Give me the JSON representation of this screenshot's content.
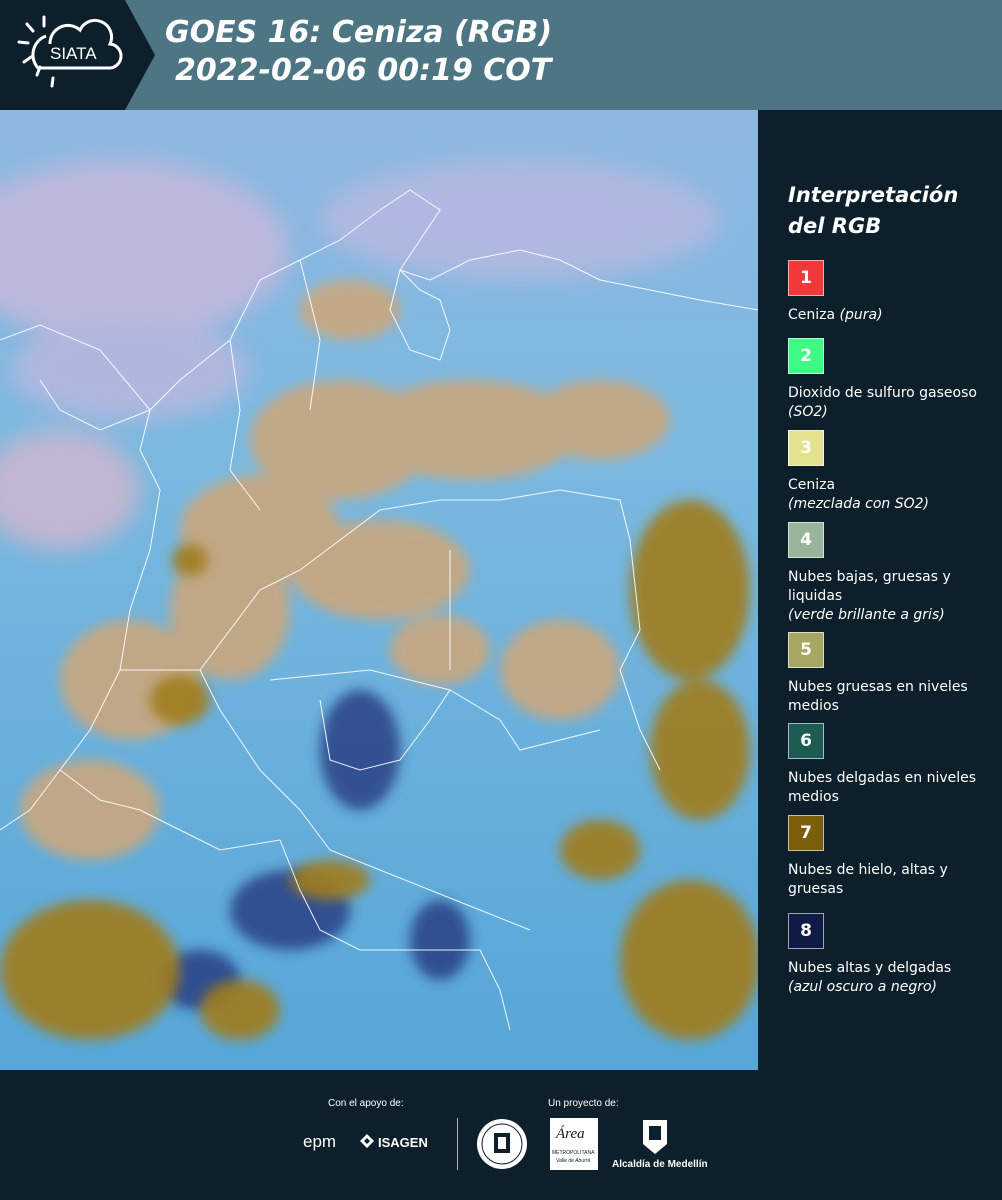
{
  "header": {
    "logo_text": "SIATA",
    "title_line1": "GOES 16: Ceniza (RGB)",
    "title_line2": "2022-02-06 00:19 COT"
  },
  "legend": {
    "title_line1": "Interpretación",
    "title_line2": "del RGB",
    "items": [
      {
        "number": "1",
        "color": "#f0393a",
        "label": "Ceniza",
        "sub": "(pura)"
      },
      {
        "number": "2",
        "color": "#3dfb85",
        "label": "Dioxido de sulfuro gaseoso",
        "sub": "(SO2)"
      },
      {
        "number": "3",
        "color": "#e4e28f",
        "label": "Ceniza",
        "sub": "(mezclada con SO2)"
      },
      {
        "number": "4",
        "color": "#98b49b",
        "label": "Nubes bajas, gruesas y liquidas",
        "sub": "(verde brillante a gris)"
      },
      {
        "number": "5",
        "color": "#a8a762",
        "label": "Nubes gruesas en niveles medios",
        "sub": ""
      },
      {
        "number": "6",
        "color": "#1d5a52",
        "label": "Nubes delgadas en niveles medios",
        "sub": ""
      },
      {
        "number": "7",
        "color": "#7a5e0c",
        "label": "Nubes de hielo, altas y gruesas",
        "sub": ""
      },
      {
        "number": "8",
        "color": "#0f1a45",
        "label": "Nubes altas y delgadas",
        "sub": "(azul oscuro a negro)"
      }
    ]
  },
  "footer": {
    "support_label": "Con el apoyo de:",
    "project_label": "Un proyecto de:",
    "epm": "epm",
    "isagen": "ISAGEN",
    "area_word": "Área",
    "area_line1": "METROPOLITANA",
    "area_line2": "Valle de Aburrá",
    "alcaldia": "Alcaldía de Medellín"
  }
}
